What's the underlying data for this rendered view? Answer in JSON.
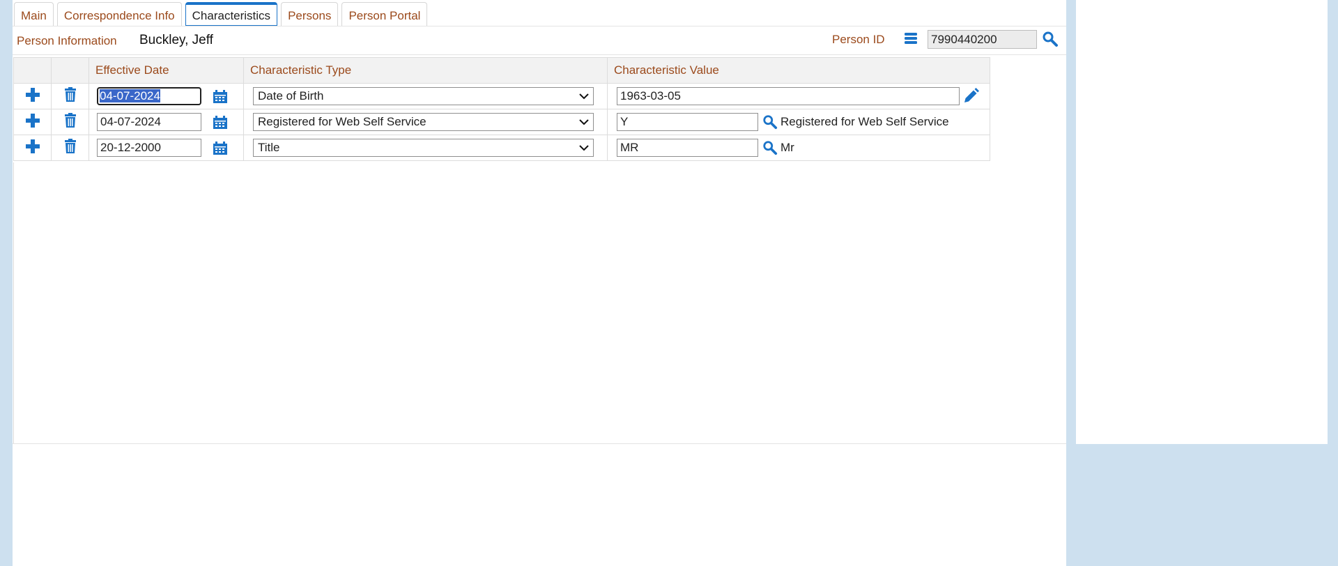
{
  "tabs": [
    {
      "label": "Main"
    },
    {
      "label": "Correspondence Info"
    },
    {
      "label": "Characteristics"
    },
    {
      "label": "Persons"
    },
    {
      "label": "Person Portal"
    }
  ],
  "active_tab": "Characteristics",
  "header": {
    "person_info_label": "Person Information",
    "person_name": "Buckley, Jeff",
    "person_id_label": "Person ID",
    "person_id_value": "7990440200"
  },
  "grid": {
    "columns": [
      "",
      "",
      "Effective Date",
      "Characteristic Type",
      "Characteristic Value"
    ],
    "rows": [
      {
        "effective_date": "04-07-2024",
        "type": "Date of Birth",
        "value": "1963-03-05",
        "description": ""
      },
      {
        "effective_date": "04-07-2024",
        "type": "Registered for Web Self Service",
        "value": "Y",
        "description": "Registered for Web Self Service"
      },
      {
        "effective_date": "20-12-2000",
        "type": "Title",
        "value": "MR",
        "description": "Mr"
      }
    ]
  },
  "colors": {
    "accent": "#1a73c8",
    "label": "#9b4a1c",
    "background": "#cde0ef"
  }
}
